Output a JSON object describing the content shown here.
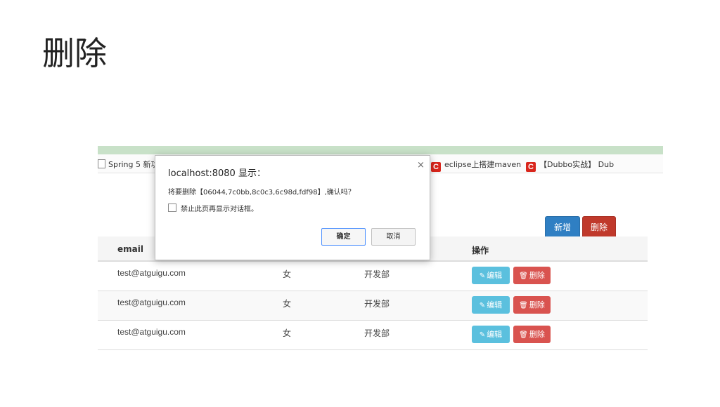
{
  "slide": {
    "title": "删除"
  },
  "browser": {
    "bookmarks": [
      {
        "label": "Spring 5 新功",
        "icon": "page-icon"
      },
      {
        "label": "eclipse上搭建maven",
        "icon": "csdn-icon"
      },
      {
        "label": "【Dubbo实战】 Dub",
        "icon": "csdn-icon"
      }
    ]
  },
  "toolbar": {
    "new_label": "新增",
    "delete_label": "删除"
  },
  "table": {
    "headers": {
      "email": "email",
      "actions": "操作"
    },
    "rows": [
      {
        "email": "test@atguigu.com",
        "gender": "女",
        "dept": "开发部",
        "edit": "编辑",
        "delete": "删除"
      },
      {
        "email": "test@atguigu.com",
        "gender": "女",
        "dept": "开发部",
        "edit": "编辑",
        "delete": "删除"
      },
      {
        "email": "test@atguigu.com",
        "gender": "女",
        "dept": "开发部",
        "edit": "编辑",
        "delete": "删除"
      }
    ]
  },
  "dialog": {
    "title": "localhost:8080 显示：",
    "close": "×",
    "message": "将要删除【06044,7c0bb,8c0c3,6c98d,fdf98】,确认吗？",
    "checkbox_label": "禁止此页再显示对话框。",
    "ok_label": "确定",
    "cancel_label": "取消"
  },
  "colors": {
    "primary": "#2f7fc3",
    "danger": "#c0392b",
    "info": "#5bc0de",
    "danger_light": "#d9534f",
    "browser_strip": "#c8e1c8"
  }
}
